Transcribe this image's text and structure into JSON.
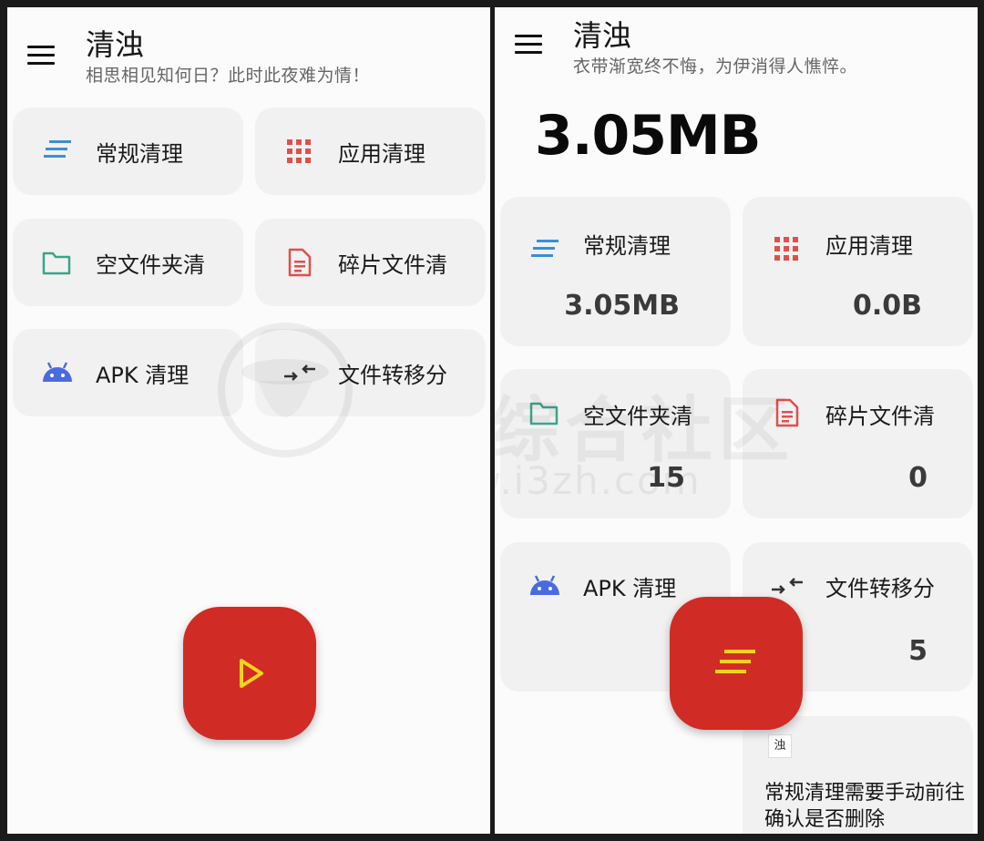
{
  "left_screen": {
    "title": "清浊",
    "subtitle": "相思相见知何日？此时此夜难为情！",
    "cards": [
      {
        "label": "常规清理",
        "icon": "lines-icon"
      },
      {
        "label": "应用清理",
        "icon": "grid-icon"
      },
      {
        "label": "空文件夹清",
        "icon": "folder-icon"
      },
      {
        "label": "碎片文件清",
        "icon": "document-icon"
      },
      {
        "label": "APK 清理",
        "icon": "android-icon"
      },
      {
        "label": "文件转移分",
        "icon": "transfer-icon"
      }
    ],
    "fab_icon": "play-icon"
  },
  "right_screen": {
    "title": "清浊",
    "subtitle": "衣带渐宽终不悔，为伊消得人憔悴。",
    "total": "3.05MB",
    "cards": [
      {
        "label": "常规清理",
        "value": "3.05MB",
        "icon": "lines-icon"
      },
      {
        "label": "应用清理",
        "value": "0.0B",
        "icon": "grid-icon"
      },
      {
        "label": "空文件夹清",
        "value": "15",
        "icon": "folder-icon"
      },
      {
        "label": "碎片文件清",
        "value": "0",
        "icon": "document-icon"
      },
      {
        "label": "APK 清理",
        "value": "",
        "icon": "android-icon"
      },
      {
        "label": "文件转移分",
        "value": "5",
        "icon": "transfer-icon"
      }
    ],
    "notice": {
      "icon_char": "浊",
      "text": "常规清理需要手动前往确认是否删除"
    },
    "fab_icon": "lines-icon"
  },
  "watermark": {
    "brand": "i3综合社区",
    "url": "www.i3zh.com"
  },
  "colors": {
    "accent_red": "#d12b25",
    "fab_icon_yellow": "#f5d31c",
    "icon_blue": "#3a8fd9",
    "icon_green": "#3aa58c",
    "icon_red": "#e0504a",
    "android_blue": "#4a6be0"
  }
}
